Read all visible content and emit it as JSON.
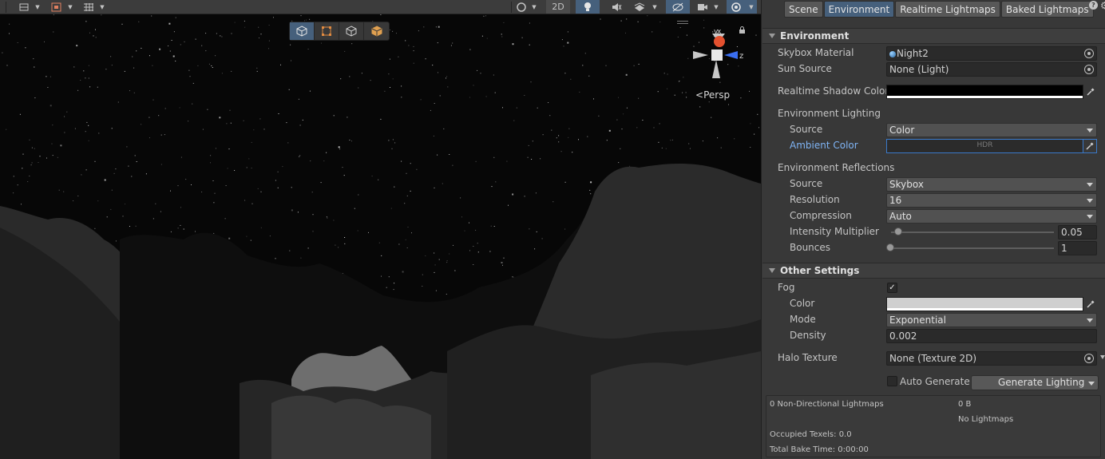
{
  "scene": {
    "toolbar": {
      "mode_2d_label": "2D"
    },
    "overlay_tools": [
      "box-tool",
      "rect-tool",
      "cube-tool",
      "mesh-tool"
    ],
    "gizmo": {
      "y_axis_label": "y",
      "x_axis_label": "x",
      "z_axis_label": "z"
    },
    "projection_label": "Persp"
  },
  "lighting": {
    "tabs": [
      {
        "label": "Scene",
        "active": false
      },
      {
        "label": "Environment",
        "active": true
      },
      {
        "label": "Realtime Lightmaps",
        "active": false
      },
      {
        "label": "Baked Lightmaps",
        "active": false
      }
    ],
    "environment": {
      "header": "Environment",
      "skybox_material_label": "Skybox Material",
      "skybox_material_value": "Night2",
      "sun_source_label": "Sun Source",
      "sun_source_value": "None (Light)",
      "realtime_shadow_color_label": "Realtime Shadow Color",
      "realtime_shadow_color": "#000000",
      "env_lighting_label": "Environment Lighting",
      "env_lighting_source_label": "Source",
      "env_lighting_source_value": "Color",
      "ambient_color_label": "Ambient Color",
      "ambient_color": "#2b2b2b",
      "ambient_hdr_label": "HDR",
      "env_reflections_label": "Environment Reflections",
      "refl_source_label": "Source",
      "refl_source_value": "Skybox",
      "resolution_label": "Resolution",
      "resolution_value": "16",
      "compression_label": "Compression",
      "compression_value": "Auto",
      "intensity_label": "Intensity Multiplier",
      "intensity_value": "0.05",
      "bounces_label": "Bounces",
      "bounces_value": "1"
    },
    "other_settings": {
      "header": "Other Settings",
      "fog_label": "Fog",
      "fog_checked": true,
      "fog_check_glyph": "✓",
      "fog_color_label": "Color",
      "fog_color": "#cfcfcf",
      "mode_label": "Mode",
      "mode_value": "Exponential",
      "density_label": "Density",
      "density_value": "0.002",
      "halo_texture_label": "Halo Texture",
      "halo_texture_value": "None (Texture 2D)"
    },
    "auto_generate_label": "Auto Generate",
    "generate_button_label": "Generate Lighting",
    "stats": {
      "non_directional": "0 Non-Directional Lightmaps",
      "size": "0 B",
      "no_lightmaps": "No Lightmaps",
      "occupied_texels": "Occupied Texels: 0.0",
      "total_bake_time": "Total Bake Time: 0:00:00"
    }
  },
  "colors": {
    "accent": "#46607c",
    "link_blue": "#7fb4f5",
    "panel_bg": "#383838",
    "scene_bg": "#070707"
  }
}
